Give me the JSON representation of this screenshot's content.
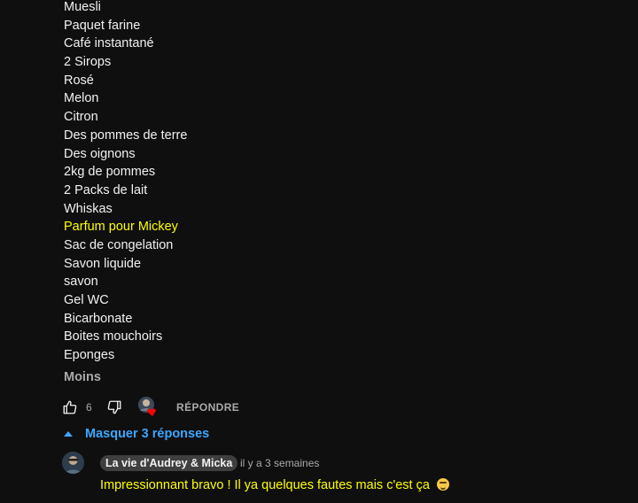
{
  "list_items": [
    "Muesli",
    "Paquet farine",
    "Café instantané",
    "2 Sirops",
    "Rosé",
    "Melon",
    "Citron",
    "Des pommes de terre",
    "Des oignons",
    "2kg de pommes",
    "2 Packs de lait",
    "Whiskas",
    "Parfum pour Mickey",
    "Sac de congelation",
    "Savon liquide",
    "savon",
    "Gel WC",
    "Bicarbonate",
    "Boites mouchoirs",
    "Eponges"
  ],
  "highlighted_index": 12,
  "show_less_label": "Moins",
  "actions": {
    "like_count": "6",
    "reply_label": "RÉPONDRE"
  },
  "replies_toggle": {
    "label": "Masquer 3 réponses"
  },
  "reply": {
    "author": "La vie d'Audrey & Micka",
    "time": "il y a 3 semaines",
    "text": "Impressionnant bravo ! Il ya quelques fautes mais c'est ça"
  },
  "colors": {
    "background": "#0f0f0f",
    "text": "#f1f1f1",
    "highlight": "#ffff00",
    "link_blue": "#3ea6ff",
    "muted": "#aaaaaa",
    "heart": "#ff0000"
  }
}
